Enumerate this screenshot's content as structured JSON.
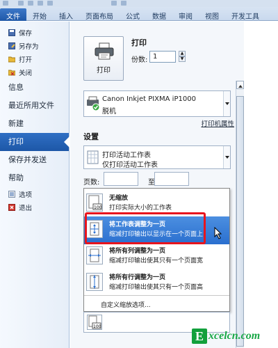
{
  "ribbon": {
    "tabs": [
      {
        "label": "文件",
        "active": true
      },
      {
        "label": "开始"
      },
      {
        "label": "插入"
      },
      {
        "label": "页面布局"
      },
      {
        "label": "公式"
      },
      {
        "label": "数据"
      },
      {
        "label": "审阅"
      },
      {
        "label": "视图"
      },
      {
        "label": "开发工具"
      }
    ]
  },
  "nav": {
    "commands": [
      {
        "label": "保存",
        "icon": "save-icon"
      },
      {
        "label": "另存为",
        "icon": "save-as-icon"
      },
      {
        "label": "打开",
        "icon": "open-folder-icon"
      },
      {
        "label": "关闭",
        "icon": "close-file-icon"
      }
    ],
    "headers": [
      {
        "label": "信息"
      },
      {
        "label": "最近所用文件"
      },
      {
        "label": "新建"
      },
      {
        "label": "打印",
        "active": true
      },
      {
        "label": "保存并发送"
      },
      {
        "label": "帮助"
      }
    ],
    "bottom_commands": [
      {
        "label": "选项",
        "icon": "options-icon"
      },
      {
        "label": "退出",
        "icon": "exit-icon"
      }
    ]
  },
  "print": {
    "button_label": "打印",
    "title": "打印",
    "copies_label": "份数:",
    "copies_value": "1",
    "printer_name": "Canon Inkjet PIXMA iP1000",
    "printer_status": "脱机",
    "printer_properties": "打印机属性",
    "settings_title": "设置",
    "sheet_option_main": "打印活动工作表",
    "sheet_option_sub": "仅打印活动工作表",
    "pages_label": "页数:",
    "to_label": "至"
  },
  "scaling_menu": {
    "options": [
      {
        "title": "无缩放",
        "desc": "打印实际大小的工作表",
        "icon": "page-100-icon"
      },
      {
        "title": "将工作表调整为一页",
        "desc": "缩减打印输出以显示在一个页面上",
        "icon": "fit-sheet-icon",
        "selected": true
      },
      {
        "title": "将所有列调整为一页",
        "desc": "缩减打印输出使其只有一个页面宽",
        "icon": "fit-columns-icon"
      },
      {
        "title": "将所有行调整为一页",
        "desc": "缩减打印输出使其只有一个页面高",
        "icon": "fit-rows-icon"
      }
    ],
    "custom_label": "自定义缩放选项..."
  },
  "watermark": {
    "initial": "E",
    "rest": "xcelcn.com"
  },
  "colors": {
    "accent": "#1d57a7",
    "highlight": "#2a6fcf",
    "annotation": "#e8141d",
    "watermark": "#12a03c"
  }
}
